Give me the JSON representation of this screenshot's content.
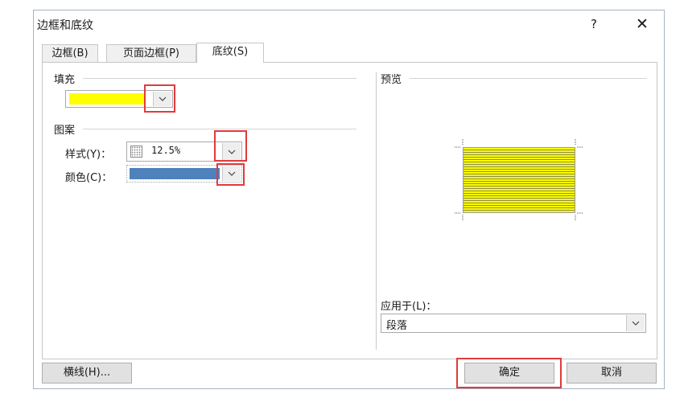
{
  "window": {
    "title": "边框和底纹",
    "help": "?",
    "close": "✕"
  },
  "tabs": [
    {
      "label": "边框(B)"
    },
    {
      "label": "页面边框(P)"
    },
    {
      "label": "底纹(S)"
    }
  ],
  "fill": {
    "section_label": "填充",
    "color": "#ffff00"
  },
  "pattern": {
    "section_label": "图案",
    "style_label": "样式(Y)：",
    "style_value": "12.5%",
    "color_label": "颜色(C)：",
    "color_value": "#4f81bd"
  },
  "preview": {
    "section_label": "预览"
  },
  "apply": {
    "label": "应用于(L)：",
    "value": "段落"
  },
  "buttons": {
    "horizontal_line": "横线(H)...",
    "ok": "确定",
    "cancel": "取消"
  },
  "colors": {
    "highlight": "#e03c3c",
    "window_border": "#a8b3c3",
    "preview_fill": "#ffff00"
  }
}
